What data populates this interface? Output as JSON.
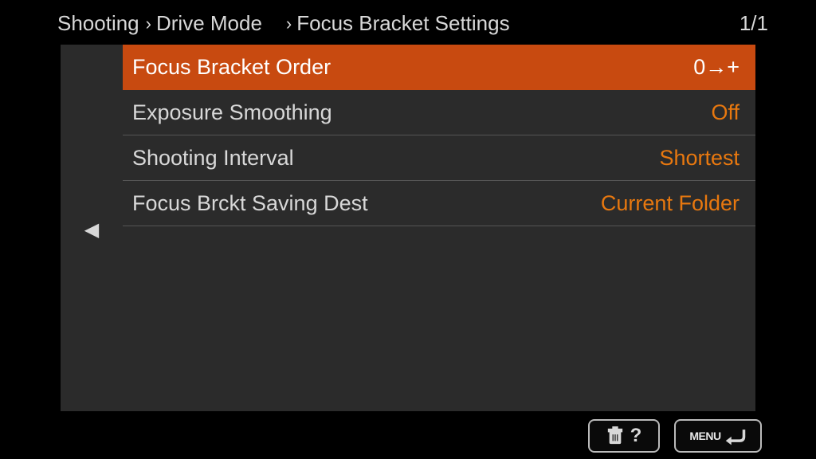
{
  "breadcrumb": {
    "level1": "Shooting",
    "level2": "Drive Mode",
    "level3": "Focus Bracket Settings"
  },
  "page_indicator": "1/1",
  "menu": {
    "items": [
      {
        "label": "Focus Bracket Order",
        "value": "0→+",
        "selected": true
      },
      {
        "label": "Exposure Smoothing",
        "value": "Off",
        "selected": false
      },
      {
        "label": "Shooting Interval",
        "value": "Shortest",
        "selected": false
      },
      {
        "label": "Focus Brckt Saving Dest",
        "value": "Current Folder",
        "selected": false
      }
    ]
  },
  "footer": {
    "help_label": "?",
    "menu_label": "MENU"
  }
}
